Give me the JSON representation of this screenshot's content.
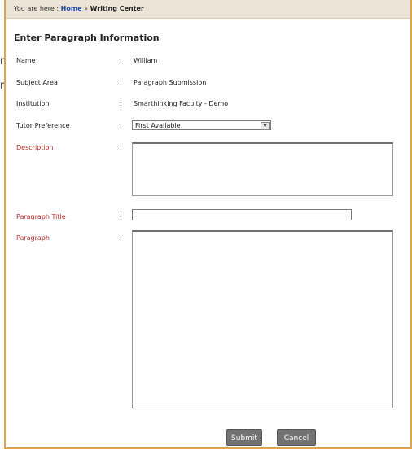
{
  "background": {
    "line1": "r",
    "line2": "n"
  },
  "breadcrumb": {
    "prefix": "You are here :",
    "home": "Home",
    "separator": "»",
    "current": "Writing Center"
  },
  "heading": "Enter Paragraph Information",
  "fields": {
    "name": {
      "label": "Name",
      "value": "William"
    },
    "subject": {
      "label": "Subject Area",
      "value": "Paragraph Submission"
    },
    "institution": {
      "label": "Institution",
      "value": "Smarthinking Faculty - Demo"
    },
    "tutor": {
      "label": "Tutor Preference",
      "value": "First Available"
    },
    "description": {
      "label": "Description",
      "value": ""
    },
    "title": {
      "label": "Paragraph Title",
      "value": ""
    },
    "paragraph": {
      "label": "Paragraph",
      "value": ""
    }
  },
  "separator_char": ":",
  "buttons": {
    "submit": "Submit",
    "cancel": "Cancel"
  },
  "colors": {
    "accent_border": "#e0a24a",
    "required_label": "#c4302b",
    "link": "#1a4aa8",
    "button": "#727272"
  }
}
